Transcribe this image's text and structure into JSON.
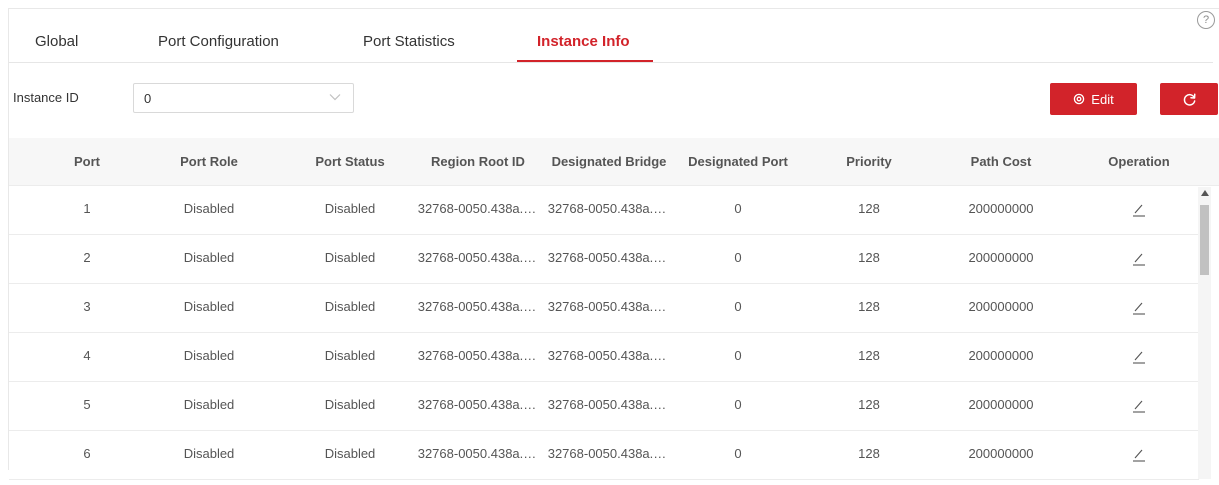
{
  "tabs": [
    {
      "label": "Global"
    },
    {
      "label": "Port Configuration"
    },
    {
      "label": "Port Statistics"
    },
    {
      "label": "Instance Info",
      "active": true
    }
  ],
  "help": {
    "glyph": "?"
  },
  "instance": {
    "label": "Instance ID",
    "value": "0"
  },
  "toolbar": {
    "edit_label": "Edit"
  },
  "colors": {
    "accent": "#d2232a"
  },
  "table": {
    "headers": [
      "Port",
      "Port Role",
      "Port Status",
      "Region Root ID",
      "Designated Bridge",
      "Designated Port",
      "Priority",
      "Path Cost",
      "Operation"
    ],
    "rows": [
      [
        "1",
        "Disabled",
        "Disabled",
        "32768-0050.438a.…",
        "32768-0050.438a.…",
        "0",
        "128",
        "200000000"
      ],
      [
        "2",
        "Disabled",
        "Disabled",
        "32768-0050.438a.…",
        "32768-0050.438a.…",
        "0",
        "128",
        "200000000"
      ],
      [
        "3",
        "Disabled",
        "Disabled",
        "32768-0050.438a.…",
        "32768-0050.438a.…",
        "0",
        "128",
        "200000000"
      ],
      [
        "4",
        "Disabled",
        "Disabled",
        "32768-0050.438a.…",
        "32768-0050.438a.…",
        "0",
        "128",
        "200000000"
      ],
      [
        "5",
        "Disabled",
        "Disabled",
        "32768-0050.438a.…",
        "32768-0050.438a.…",
        "0",
        "128",
        "200000000"
      ],
      [
        "6",
        "Disabled",
        "Disabled",
        "32768-0050.438a.…",
        "32768-0050.438a.…",
        "0",
        "128",
        "200000000"
      ]
    ]
  }
}
